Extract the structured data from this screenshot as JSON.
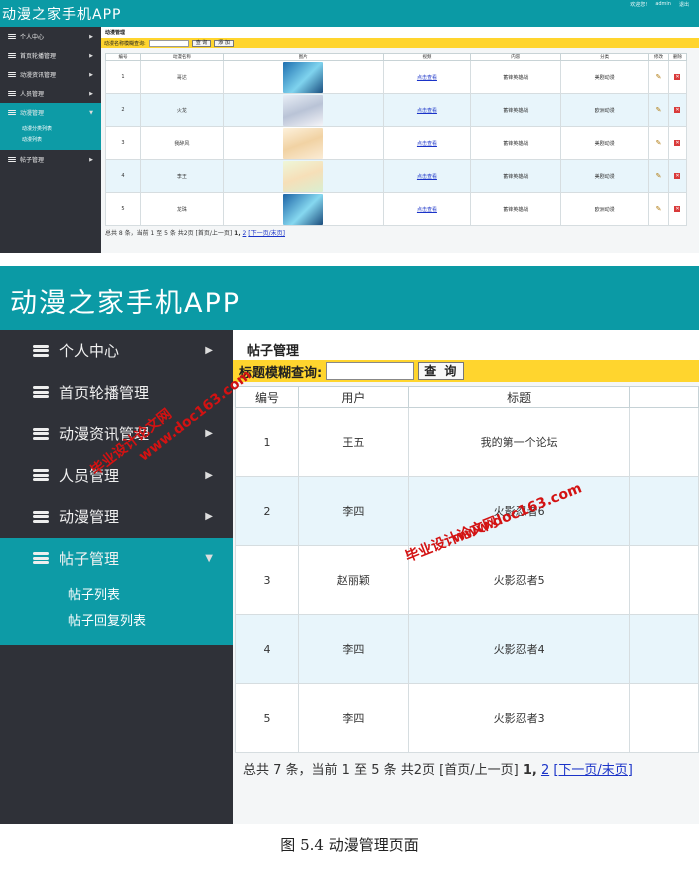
{
  "shot1": {
    "app_title": "动漫之家手机APP",
    "top_links": [
      "欢迎您!",
      "admin",
      "退出"
    ],
    "sidebar": [
      {
        "label": "个人中心",
        "arrow": "▶"
      },
      {
        "label": "首页轮播管理",
        "arrow": "▶"
      },
      {
        "label": "动漫资讯管理",
        "arrow": "▶"
      },
      {
        "label": "人员管理",
        "arrow": "▶"
      },
      {
        "label": "动漫管理",
        "arrow": "▼",
        "active": true
      },
      {
        "label": "帖子管理",
        "arrow": "▶"
      }
    ],
    "submenu": [
      "动漫分类列表",
      "动漫列表"
    ],
    "breadcrumb": "动漫管理",
    "filter_label": "动漫名称模糊查询:",
    "search_button": "查 询",
    "add_button": "添 加",
    "headers": [
      "编号",
      "动漫名称",
      "图片",
      "视频",
      "内容",
      "分类",
      "修改",
      "删除"
    ],
    "rows": [
      {
        "id": "1",
        "name": "哥达",
        "video": "点击查看",
        "content": "蓄锋英雄战",
        "category": "美剧动漫"
      },
      {
        "id": "2",
        "name": "火龙",
        "video": "点击查看",
        "content": "蓄锋英雄战",
        "category": "欧洲动漫"
      },
      {
        "id": "3",
        "name": "我醉风",
        "video": "点击查看",
        "content": "蓄锋英雄战",
        "category": "美剧动漫"
      },
      {
        "id": "4",
        "name": "李王",
        "video": "点击查看",
        "content": "蓄锋英雄战",
        "category": "美剧动漫"
      },
      {
        "id": "5",
        "name": "龙珠",
        "video": "点击查看",
        "content": "蓄锋英雄战",
        "category": "欧洲动漫"
      }
    ],
    "pager_text": "总共 8 条，当前 1 至 5 条 共2页 [首页/上一页]",
    "pager_current": "1,",
    "pager_page2": "2",
    "pager_next": "[下一页/末页]"
  },
  "shot2": {
    "app_title": "动漫之家手机APP",
    "sidebar": [
      {
        "label": "个人中心",
        "arrow": "▶"
      },
      {
        "label": "首页轮播管理",
        "arrow": ""
      },
      {
        "label": "动漫资讯管理",
        "arrow": "▶"
      },
      {
        "label": "人员管理",
        "arrow": "▶"
      },
      {
        "label": "动漫管理",
        "arrow": "▶"
      },
      {
        "label": "帖子管理",
        "arrow": "▼",
        "active": true
      }
    ],
    "submenu": [
      "帖子列表",
      "帖子回复列表"
    ],
    "breadcrumb": "帖子管理",
    "filter_label": "标题模糊查询:",
    "search_button": "查 询",
    "headers": [
      "编号",
      "用户",
      "标题",
      ""
    ],
    "rows": [
      {
        "id": "1",
        "user": "王五",
        "title": "我的第一个论坛"
      },
      {
        "id": "2",
        "user": "李四",
        "title": "火影忍者6"
      },
      {
        "id": "3",
        "user": "赵丽颖",
        "title": "火影忍者5"
      },
      {
        "id": "4",
        "user": "李四",
        "title": "火影忍者4"
      },
      {
        "id": "5",
        "user": "李四",
        "title": "火影忍者3"
      }
    ],
    "pager_text": "总共 7 条，当前 1 至 5 条 共2页 [首页/上一页]",
    "pager_current": "1,",
    "pager_page2": "2",
    "pager_next": "[下一页/末页]"
  },
  "watermarks": [
    "毕业设计论文网",
    "www.doc163.com"
  ],
  "caption": "图 5.4 动漫管理页面",
  "colors": {
    "header": "#0b9aa5",
    "sidebar": "#2f3138",
    "active": "#0d9ba6",
    "filter": "#ffd52e",
    "row_alt": "#e8f5fb"
  }
}
